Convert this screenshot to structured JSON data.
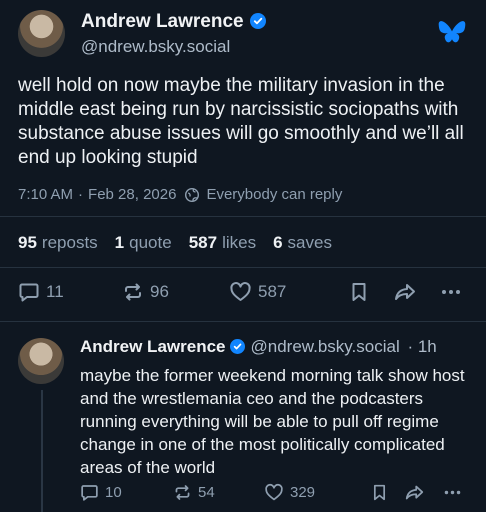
{
  "main_post": {
    "author": {
      "display_name": "Andrew Lawrence",
      "handle": "@ndrew.bsky.social"
    },
    "text": "well hold on now maybe the military invasion in the middle east being run by narcissistic sociopaths with substance abuse issues will go smoothly and we’ll all end up looking stupid",
    "time": "7:10 AM",
    "separator": "·",
    "date": "Feb 28, 2026",
    "reply_setting": "Everybody can reply",
    "stats": {
      "reposts_count": "95",
      "reposts_label": "reposts",
      "quotes_count": "1",
      "quotes_label": "quote",
      "likes_count": "587",
      "likes_label": "likes",
      "saves_count": "6",
      "saves_label": "saves"
    },
    "actions": {
      "replies": "11",
      "reposts": "96",
      "likes": "587"
    }
  },
  "reply_post": {
    "author": {
      "display_name": "Andrew Lawrence",
      "handle": "@ndrew.bsky.social",
      "age": "· 1h"
    },
    "text": "maybe the former weekend morning talk show host and the wrestlemania ceo and the podcasters running everything will be able to pull off regime change in one of the most politically complicated areas of the world",
    "actions": {
      "replies": "10",
      "reposts": "54",
      "likes": "329"
    }
  },
  "colors": {
    "background": "#0f1721",
    "brand_blue": "#1185fe",
    "muted_text": "#8f9fb0"
  },
  "icons": {
    "brand": "butterfly-logo-icon",
    "verified": "verified-check-icon",
    "reply_setting": "globe-icon",
    "reply": "reply-bubble-icon",
    "repost": "repost-arrows-icon",
    "like": "heart-icon",
    "bookmark": "bookmark-icon",
    "share": "share-arrow-icon",
    "more": "more-dots-icon"
  }
}
